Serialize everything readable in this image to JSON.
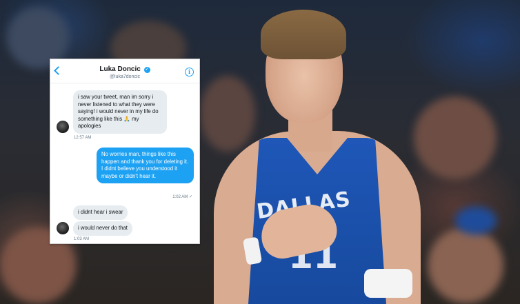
{
  "chat": {
    "header": {
      "name": "Luka Doncic",
      "handle": "@luka7doncic"
    },
    "messages": [
      {
        "direction": "incoming",
        "text": "i saw your tweet, man im sorry i never listened to what they were saying! i would never in my life do something like this 🙏 my apologies"
      },
      {
        "direction": "incoming-time",
        "text": "12:57 AM"
      },
      {
        "direction": "outgoing",
        "text": "No worries man, things like this happen and thank you for deleting it. I didnt believe you understood it maybe or didn't hear it."
      },
      {
        "direction": "outgoing-time",
        "text": "1:02 AM ✓"
      },
      {
        "direction": "incoming",
        "text": "i didnt hear i swear"
      },
      {
        "direction": "incoming",
        "text": "i would never do that"
      },
      {
        "direction": "incoming-time",
        "text": "1:03 AM"
      }
    ]
  },
  "photo": {
    "jersey_text": "DALLAS",
    "jersey_number": "11"
  },
  "colors": {
    "accent": "#1da1f2",
    "incoming_bubble": "#e6ecf0",
    "jersey_blue": "#1f57b8"
  },
  "icons": {
    "back": "chevron-left-icon",
    "verified": "verified-badge-icon",
    "info": "info-icon"
  }
}
